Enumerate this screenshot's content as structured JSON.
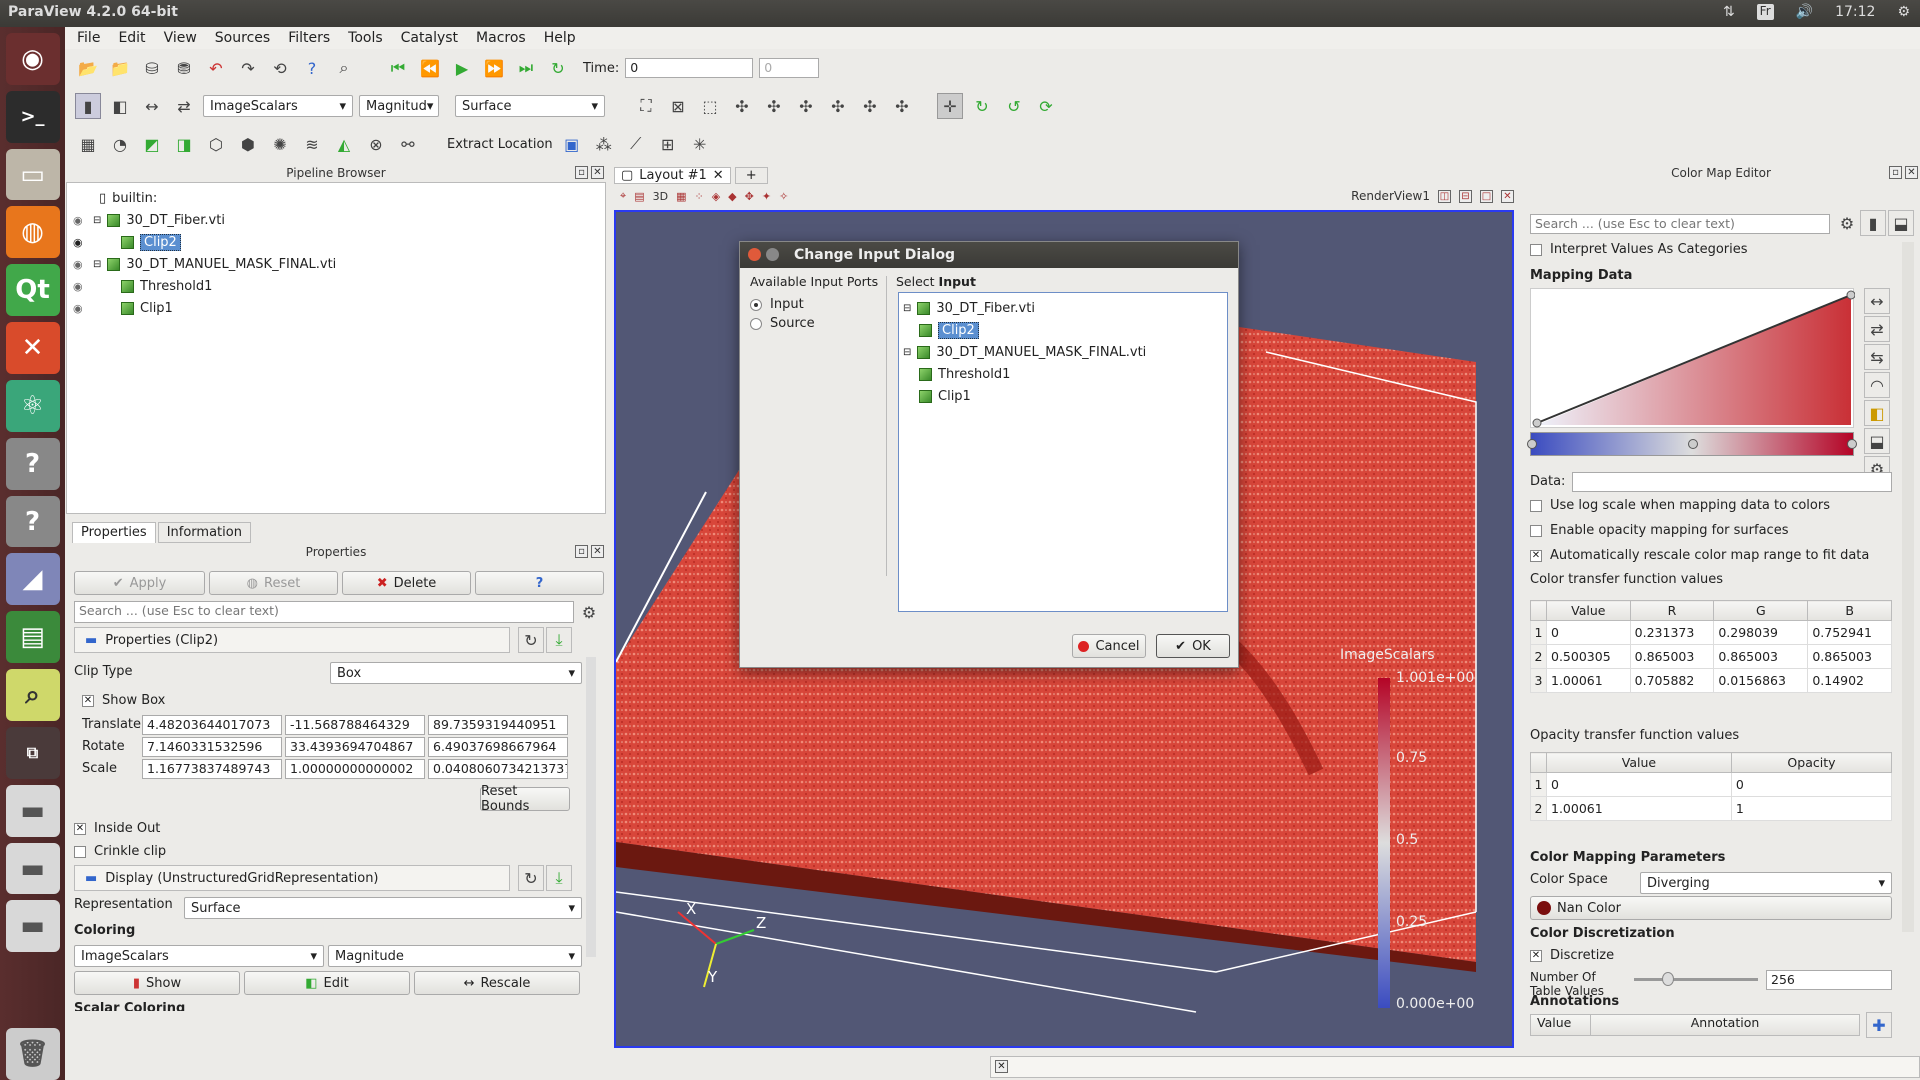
{
  "topbar": {
    "title": "ParaView 4.2.0 64-bit",
    "lang": "Fr",
    "time": "17:12"
  },
  "menu": [
    "File",
    "Edit",
    "View",
    "Sources",
    "Filters",
    "Tools",
    "Catalyst",
    "Macros",
    "Help"
  ],
  "toolbar1": {
    "time_label": "Time:",
    "time_value": "0",
    "time_index": "0"
  },
  "toolbar2": {
    "array": "ImageScalars",
    "component": "Magnitud",
    "representation": "Surface"
  },
  "toolbar3": {
    "extract_label": "Extract Location"
  },
  "pipeline": {
    "title": "Pipeline Browser",
    "root": "builtin:",
    "items": [
      "30_DT_Fiber.vti",
      "Clip2",
      "30_DT_MANUEL_MASK_FINAL.vti",
      "Threshold1",
      "Clip1"
    ]
  },
  "tabs": {
    "properties": "Properties",
    "information": "Information"
  },
  "properties": {
    "title": "Properties",
    "apply": "Apply",
    "reset": "Reset",
    "delete": "Delete",
    "help": "?",
    "search_placeholder": "Search ... (use Esc to clear text)",
    "section": "Properties (Clip2)",
    "clip_type_label": "Clip Type",
    "clip_type": "Box",
    "show_box": "Show Box",
    "translate_label": "Translate",
    "translate": [
      "4.48203644017073",
      "-11.568788464329",
      "89.7359319440951"
    ],
    "rotate_label": "Rotate",
    "rotate": [
      "7.1460331532596",
      "33.4393694704867",
      "6.49037698667964"
    ],
    "scale_label": "Scale",
    "scale": [
      "1.16773837489743",
      "1.00000000000002",
      "0.0408060734213737"
    ],
    "reset_bounds": "Reset Bounds",
    "inside_out": "Inside Out",
    "crinkle": "Crinkle clip",
    "display_section": "Display (UnstructuredGridRepresentation)",
    "representation_label": "Representation",
    "representation": "Surface",
    "coloring_label": "Coloring",
    "color_array": "ImageScalars",
    "color_component": "Magnitude",
    "show": "Show",
    "edit": "Edit",
    "rescale": "Rescale",
    "scalar_coloring": "Scalar Coloring"
  },
  "layout": {
    "tab": "Layout #1",
    "plus": "+",
    "view_label": "RenderView1",
    "view_3d": "3D"
  },
  "view": {
    "colorbar_title": "ImageScalars",
    "ticks": [
      "1.001e+00",
      "0.75",
      "0.5",
      "0.25",
      "0.000e+00"
    ],
    "axes": [
      "X",
      "Y",
      "Z"
    ]
  },
  "dialog": {
    "title": "Change Input Dialog",
    "ports_label": "Available Input Ports",
    "ports": [
      "Input",
      "Source"
    ],
    "select_prefix": "Select ",
    "select_bold": "Input",
    "tree": [
      "30_DT_Fiber.vti",
      "Clip2",
      "30_DT_MANUEL_MASK_FINAL.vti",
      "Threshold1",
      "Clip1"
    ],
    "cancel": "Cancel",
    "ok": "OK"
  },
  "cme": {
    "title": "Color Map Editor",
    "search_placeholder": "Search ... (use Esc to clear text)",
    "interpret": "Interpret Values As Categories",
    "mapping": "Mapping Data",
    "data_label": "Data:",
    "log": "Use log scale when mapping data to colors",
    "opacity_map": "Enable opacity mapping for surfaces",
    "autorescale": "Automatically rescale color map range to fit data",
    "ctf_label": "Color transfer function values",
    "ctf_headers": [
      "Value",
      "R",
      "G",
      "B"
    ],
    "ctf_rows": [
      [
        "1",
        "0",
        "0.231373",
        "0.298039",
        "0.752941"
      ],
      [
        "2",
        "0.500305",
        "0.865003",
        "0.865003",
        "0.865003"
      ],
      [
        "3",
        "1.00061",
        "0.705882",
        "0.0156863",
        "0.14902"
      ]
    ],
    "otf_label": "Opacity transfer function values",
    "otf_headers": [
      "Value",
      "Opacity"
    ],
    "otf_rows": [
      [
        "1",
        "0",
        "0"
      ],
      [
        "2",
        "1.00061",
        "1"
      ]
    ],
    "params": "Color Mapping Parameters",
    "space_label": "Color Space",
    "space": "Diverging",
    "nan": "Nan Color",
    "discretization": "Color Discretization",
    "discretize": "Discretize",
    "table_values_label": "Number Of Table Values",
    "table_values": "256",
    "annotations": "Annotations",
    "ann_headers": [
      "Value",
      "Annotation"
    ]
  },
  "colors": {
    "accent": "#5b8fd0",
    "view_bg": "#525775",
    "launcher": "#4a2626"
  }
}
